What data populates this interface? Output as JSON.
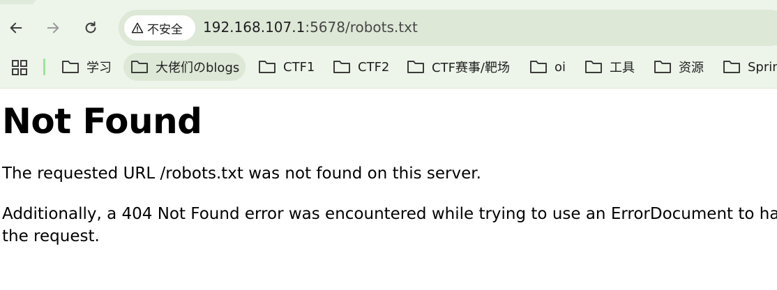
{
  "browser": {
    "security_label": "不安全",
    "url_host": "192.168.107.1",
    "url_path": ":5678/robots.txt"
  },
  "bookmarks": [
    {
      "label": "学习"
    },
    {
      "label": "大佬们のblogs"
    },
    {
      "label": "CTF1"
    },
    {
      "label": "CTF2"
    },
    {
      "label": "CTF赛事/靶场"
    },
    {
      "label": "oi"
    },
    {
      "label": "工具"
    },
    {
      "label": "资源"
    },
    {
      "label": "Sprin"
    }
  ],
  "page": {
    "heading": "Not Found",
    "message": "The requested URL /robots.txt was not found on this server.",
    "additional": "Additionally, a 404 Not Found error was encountered while trying to use an ErrorDocument to handle the request."
  },
  "colors": {
    "chrome_bg": "#edf4e9",
    "omnibox_bg": "#dde8d7",
    "separator": "#9ee29c"
  },
  "icons": [
    "back-arrow-icon",
    "forward-arrow-icon",
    "reload-icon",
    "warning-icon",
    "apps-grid-icon",
    "folder-icon"
  ]
}
